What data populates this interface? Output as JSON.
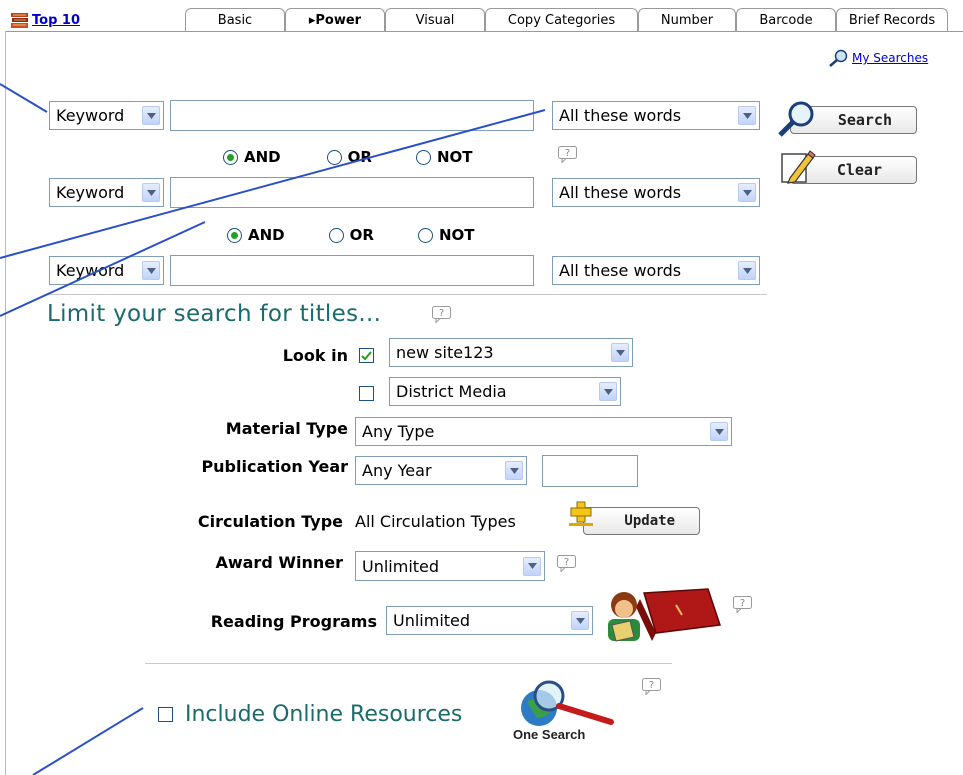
{
  "top_link": {
    "label": "Top 10",
    "icon": "books-icon"
  },
  "tabs": [
    {
      "label": "Basic",
      "active": false
    },
    {
      "label": "▸Power",
      "active": true
    },
    {
      "label": "Visual",
      "active": false
    },
    {
      "label": "Copy Categories",
      "active": false
    },
    {
      "label": "Number",
      "active": false
    },
    {
      "label": "Barcode",
      "active": false
    },
    {
      "label": "Brief Records",
      "active": false
    }
  ],
  "my_searches": {
    "label": "My Searches",
    "icon": "magnifier-icon"
  },
  "search_rows": [
    {
      "field": "Keyword",
      "term": "",
      "match": "All these words"
    },
    {
      "field": "Keyword",
      "term": "",
      "match": "All these words"
    },
    {
      "field": "Keyword",
      "term": "",
      "match": "All these words"
    }
  ],
  "boolean_ops": {
    "and": "AND",
    "or": "OR",
    "not": "NOT",
    "selected": "AND"
  },
  "buttons": {
    "search": "Search",
    "clear": "Clear",
    "update": "Update"
  },
  "limit": {
    "heading": "Limit your search for titles...",
    "look_in_label": "Look in",
    "look_in": [
      {
        "value": "new site123",
        "checked": true
      },
      {
        "value": "District Media",
        "checked": false
      }
    ],
    "material_type_label": "Material Type",
    "material_type_value": "Any Type",
    "publication_year_label": "Publication Year",
    "publication_year_value": "Any Year",
    "publication_year_input": "",
    "circulation_type_label": "Circulation Type",
    "circulation_type_value": "All Circulation Types",
    "award_winner_label": "Award Winner",
    "award_winner_value": "Unlimited",
    "reading_programs_label": "Reading Programs",
    "reading_programs_value": "Unlimited"
  },
  "online": {
    "label": "Include Online Resources",
    "checked": false,
    "one_search_label": "One Search"
  },
  "colors": {
    "heading": "#1a6b6b",
    "link": "#0000cc",
    "callout": "#2a50c8",
    "radio_dot": "#21a121"
  }
}
